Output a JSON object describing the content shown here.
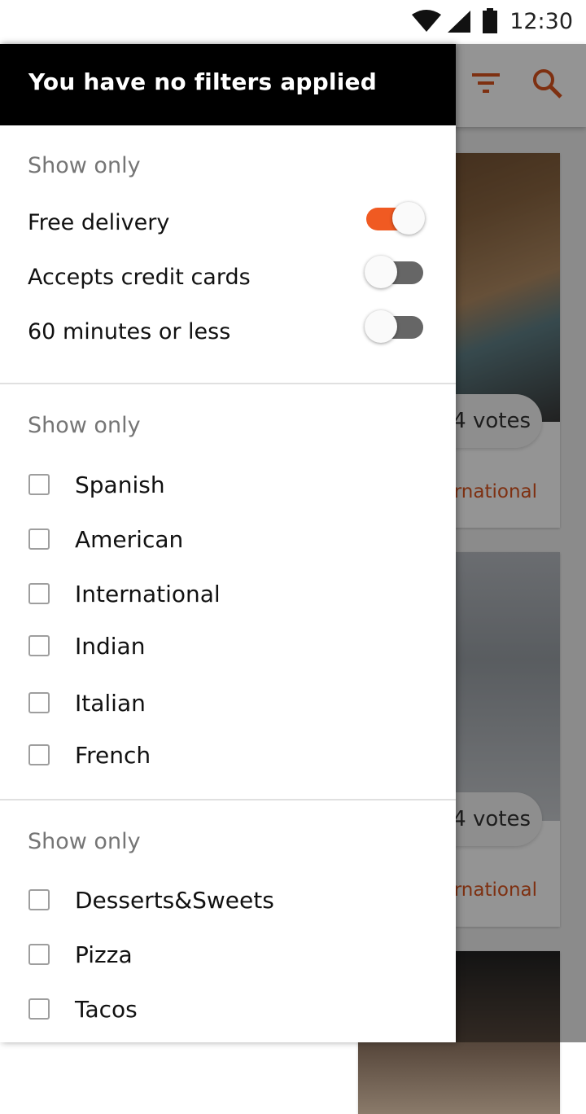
{
  "status_bar": {
    "time": "12:30"
  },
  "app": {
    "cards": [
      {
        "votes": "4 votes",
        "cuisine": "rnational"
      },
      {
        "votes": "4 votes",
        "cuisine": "rnational"
      }
    ]
  },
  "drawer": {
    "header": "You have no filters applied",
    "sections": [
      {
        "label": "Show only",
        "toggles": [
          {
            "label": "Free delivery",
            "on": true
          },
          {
            "label": "Accepts credit cards",
            "on": false
          },
          {
            "label": "60 minutes or less",
            "on": false
          }
        ]
      },
      {
        "label": "Show only",
        "options": [
          "Spanish",
          "American",
          "International",
          "Indian",
          "Italian",
          "French"
        ]
      },
      {
        "label": "Show only",
        "options": [
          "Desserts&Sweets",
          "Pizza",
          "Tacos"
        ]
      }
    ]
  },
  "colors": {
    "accent": "#f05a22",
    "header_bg": "#000000",
    "switch_off": "#666666"
  }
}
